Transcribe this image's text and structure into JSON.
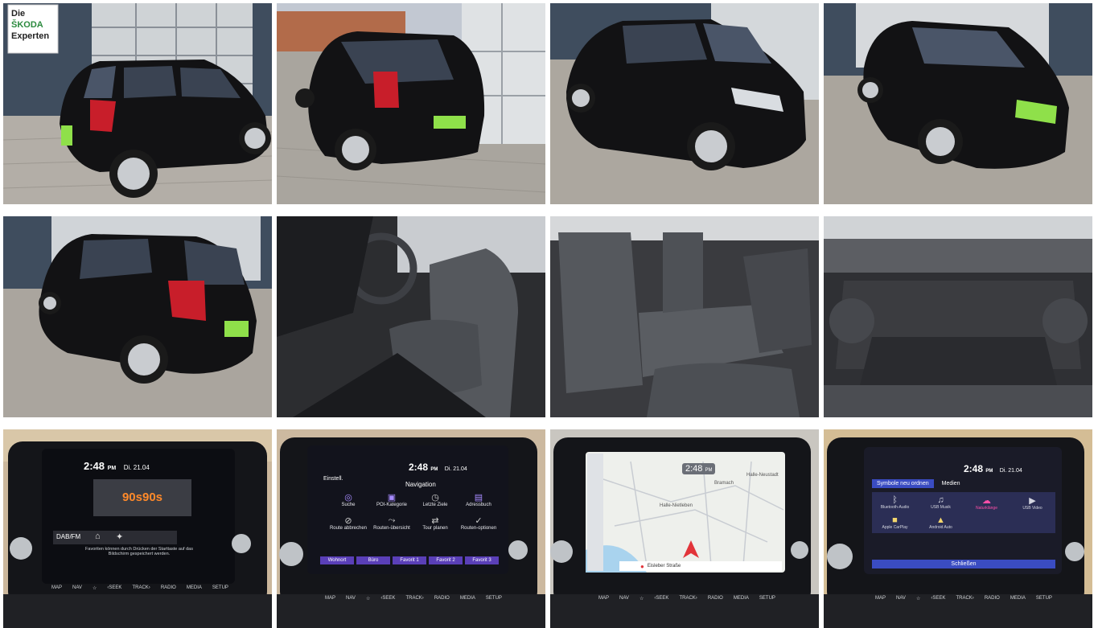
{
  "gallery": {
    "tiles": [
      {
        "id": "car-rear-left-showroom",
        "sign_line1": "Die",
        "sign_line2": "ŠKODA",
        "sign_line3": "Experten"
      },
      {
        "id": "car-rear-right-street"
      },
      {
        "id": "car-front-right-showroom"
      },
      {
        "id": "car-front-angle-showroom"
      },
      {
        "id": "car-rear-left-angle"
      },
      {
        "id": "front-seats-interior"
      },
      {
        "id": "rear-seats-interior"
      },
      {
        "id": "trunk-open"
      },
      {
        "id": "infotainment-radio",
        "time": "2:48",
        "ampm": "PM",
        "date": "Di. 21.04",
        "station": "90s90s",
        "band": "DAB/FM",
        "hint_line1": "Favoriten können durch Drücken der Starttaste auf das",
        "hint_line2": "Bildschirm gespeichert werden."
      },
      {
        "id": "infotainment-navigation-menu",
        "time": "2:48",
        "ampm": "PM",
        "date": "Di. 21.04",
        "left_label": "Einstell.",
        "title": "Navigation",
        "items": [
          "Suche",
          "POI-Kategorie",
          "Letzte Ziele",
          "Adressbuch",
          "Route abbrechen",
          "Routen-übersicht",
          "Tour planen",
          "Routen-optionen"
        ],
        "favorites": [
          "Wohnort",
          "Büro",
          "Favorit 1",
          "Favorit 2",
          "Favorit 3"
        ]
      },
      {
        "id": "infotainment-map",
        "time": "2:48",
        "ampm": "PM",
        "place1": "Halle-Nietleben",
        "place2": "Bramach",
        "place3": "Halle-Neustadt",
        "street": "Eisleber Straße"
      },
      {
        "id": "infotainment-media-icons",
        "time": "2:48",
        "ampm": "PM",
        "date": "Di. 21.04",
        "tab1": "Symbole neu ordnen",
        "tab2": "Medien",
        "items": [
          "Bluetooth-Audio",
          "USB Musik",
          "Naturklänge",
          "USB Video",
          "Apple CarPlay",
          "Android Auto"
        ],
        "close": "Schließen"
      }
    ],
    "console_buttons": [
      "MAP",
      "NAV",
      "☆",
      "‹SEEK",
      "TRACK›",
      "RADIO",
      "MEDIA",
      "SETUP"
    ]
  },
  "colors": {
    "car": "#121214",
    "pavement": "#a8a39c",
    "wall": "#3c4a5a",
    "screen": "#0e1018",
    "accent": "#ff8a2a"
  }
}
